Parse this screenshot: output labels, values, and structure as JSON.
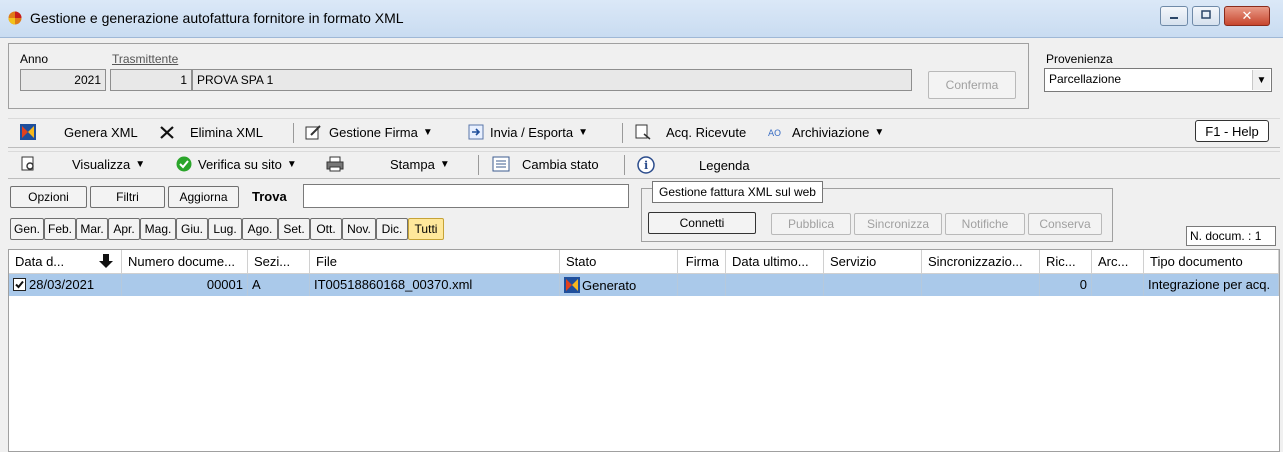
{
  "window": {
    "title": "Gestione e generazione autofattura fornitore in formato XML"
  },
  "header": {
    "anno_label": "Anno",
    "anno_value": "2021",
    "trasmittente_label": "Trasmittente",
    "trasmittente_code": "1",
    "trasmittente_name": "PROVA SPA 1",
    "conferma_label": "Conferma",
    "provenienza_label": "Provenienza",
    "provenienza_value": "Parcellazione"
  },
  "toolbar1": {
    "genera_xml": "Genera XML",
    "elimina_xml": "Elimina XML",
    "gestione_firma": "Gestione Firma",
    "invia_esporta": "Invia / Esporta",
    "acq_ricevute": "Acq. Ricevute",
    "archiviazione": "Archiviazione",
    "help": "F1 - Help"
  },
  "toolbar2": {
    "visualizza": "Visualizza",
    "verifica_su_sito": "Verifica su sito",
    "stampa": "Stampa",
    "cambia_stato": "Cambia stato",
    "legenda": "Legenda"
  },
  "filters": {
    "opzioni": "Opzioni",
    "filtri": "Filtri",
    "aggiorna": "Aggiorna",
    "trova_label": "Trova",
    "trova_value": "",
    "months": [
      "Gen.",
      "Feb.",
      "Mar.",
      "Apr.",
      "Mag.",
      "Giu.",
      "Lug.",
      "Ago.",
      "Set.",
      "Ott.",
      "Nov.",
      "Dic.",
      "Tutti"
    ]
  },
  "web": {
    "title": "Gestione fattura XML sul web",
    "connetti": "Connetti",
    "pubblica": "Pubblica",
    "sincronizza": "Sincronizza",
    "notifiche": "Notifiche",
    "conserva": "Conserva"
  },
  "ndocum": "N. docum. : 1",
  "table": {
    "columns": [
      "Data d...",
      "Numero docume...",
      "Sezi...",
      "File",
      "Stato",
      "Firma",
      "Data ultimo...",
      "Servizio",
      "Sincronizzazio...",
      "Ric...",
      "Arc...",
      "Tipo documento"
    ],
    "rows": [
      {
        "data": "28/03/2021",
        "numero": "00001",
        "sezione": "A",
        "file": "IT00518860168_00370.xml",
        "stato": "Generato",
        "firma": "",
        "data_ultimo": "",
        "servizio": "",
        "sincronizzazione": "",
        "ric": "0",
        "arc": "",
        "tipo": "Integrazione per acq."
      }
    ]
  },
  "colors": {
    "selection": "#aac9ea",
    "active_month": "#ffe89b",
    "verifica_icon": "#2aa52a"
  },
  "icons": [
    "app-icon",
    "genera-xml-icon",
    "elimina-icon",
    "firma-icon",
    "invia-icon",
    "ricevute-icon",
    "archiviazione-icon",
    "visualizza-icon",
    "check-icon",
    "printer-icon",
    "cambia-stato-icon",
    "info-icon",
    "sort-down-icon",
    "checkbox-icon"
  ]
}
